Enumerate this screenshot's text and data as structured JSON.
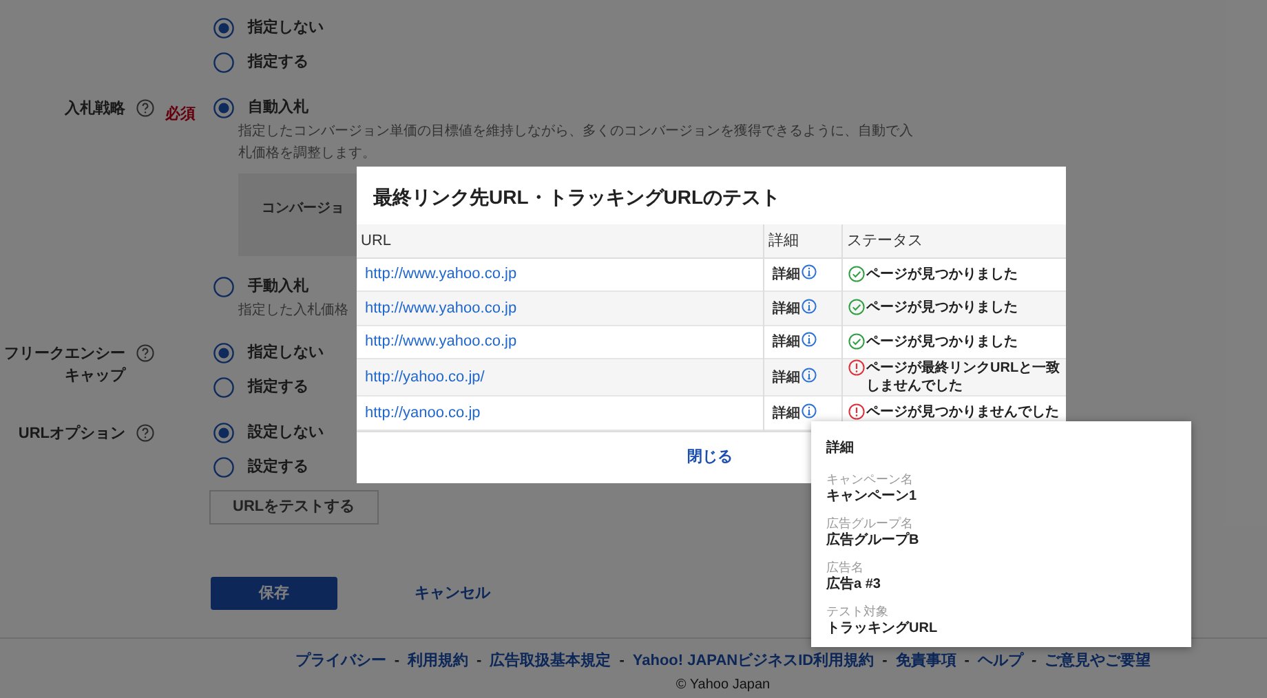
{
  "form": {
    "sections": [
      {
        "options": [
          {
            "label": "指定しない",
            "selected": true
          },
          {
            "label": "指定する",
            "selected": false
          }
        ]
      },
      {
        "label": "入札戦略",
        "help": true,
        "required": "必須",
        "options": [
          {
            "label": "自動入札",
            "selected": true,
            "description": "指定したコンバージョン単価の目標値を維持しながら、多くのコンバージョンを獲得できるように、自動で入札価格を調整します。",
            "box_text": "コンバージョ"
          },
          {
            "label": "手動入札",
            "selected": false,
            "description": "指定した入札価格"
          }
        ]
      },
      {
        "label": "フリークエンシーキャップ",
        "help": true,
        "options": [
          {
            "label": "指定しない",
            "selected": true
          },
          {
            "label": "指定する",
            "selected": false
          }
        ]
      },
      {
        "label": "URLオプション",
        "help": true,
        "options": [
          {
            "label": "設定しない",
            "selected": true
          },
          {
            "label": "設定する",
            "selected": false
          }
        ],
        "button": "URLをテストする"
      }
    ],
    "save": "保存",
    "cancel": "キャンセル"
  },
  "footer": {
    "links": [
      "プライバシー",
      "利用規約",
      "広告取扱基本規定",
      "Yahoo! JAPANビジネスID利用規約",
      "免責事項",
      "ヘルプ",
      "ご意見やご要望"
    ],
    "separator": "-",
    "copyright": "© Yahoo Japan"
  },
  "modal": {
    "title": "最終リンク先URL・トラッキングURLのテスト",
    "columns": [
      "URL",
      "詳細",
      "ステータス"
    ],
    "rows": [
      {
        "url": "http://www.yahoo.co.jp",
        "detail": "詳細",
        "status": {
          "kind": "ok",
          "text": "ページが見つかりました"
        }
      },
      {
        "url": "http://www.yahoo.co.jp",
        "detail": "詳細",
        "status": {
          "kind": "ok",
          "text": "ページが見つかりました"
        }
      },
      {
        "url": "http://www.yahoo.co.jp",
        "detail": "詳細",
        "status": {
          "kind": "ok",
          "text": "ページが見つかりました"
        }
      },
      {
        "url": "http://yahoo.co.jp/",
        "detail": "詳細",
        "status": {
          "kind": "error",
          "text": "ページが最終リンクURLと一致しませんでした"
        }
      },
      {
        "url": "http://yanoo.co.jp",
        "detail": "詳細",
        "status": {
          "kind": "error",
          "text": "ページが見つかりませんでした"
        }
      }
    ],
    "close": "閉じる"
  },
  "popover": {
    "title": "詳細",
    "fields": [
      {
        "label": "キャンペーン名",
        "value": "キャンペーン1"
      },
      {
        "label": "広告グループ名",
        "value": "広告グループB"
      },
      {
        "label": "広告名",
        "value": "広告a #3"
      },
      {
        "label": "テスト対象",
        "value": "トラッキングURL"
      }
    ]
  }
}
